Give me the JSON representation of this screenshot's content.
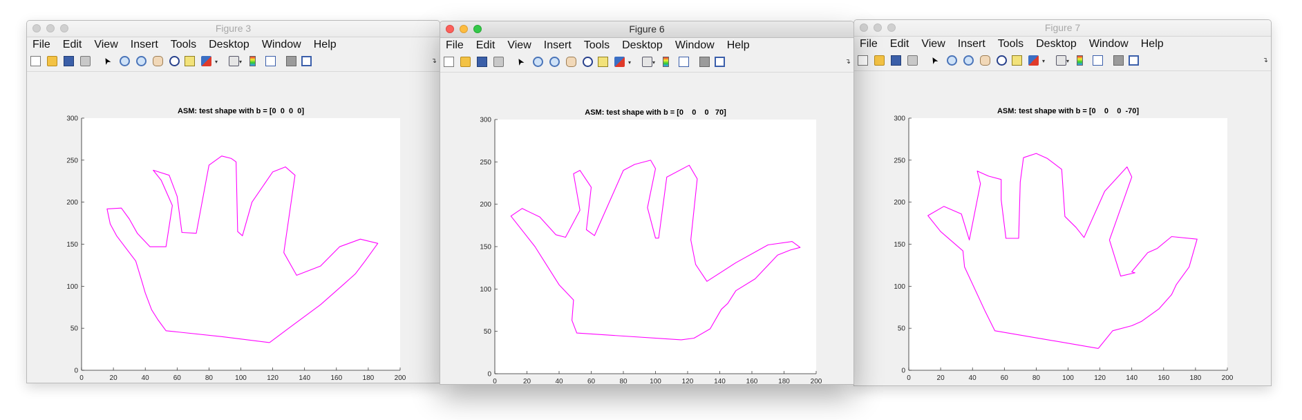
{
  "menus": [
    "File",
    "Edit",
    "View",
    "Insert",
    "Tools",
    "Desktop",
    "Window",
    "Help"
  ],
  "toolbar_icons": [
    "new-file-icon",
    "open-folder-icon",
    "save-icon",
    "print-icon",
    "pointer-icon",
    "zoom-in-icon",
    "zoom-out-icon",
    "pan-icon",
    "rotate-3d-icon",
    "data-cursor-icon",
    "brush-icon",
    "link-plot-icon",
    "colorbar-icon",
    "legend-icon",
    "hide-plot-tools-icon",
    "show-plot-tools-icon"
  ],
  "colors": {
    "curve": "#ff00ff",
    "axes_bg": "#ffffff",
    "figure_bg": "#f0f0f0"
  },
  "windows": [
    {
      "id": "figure3",
      "title": "Figure 3",
      "active": false
    },
    {
      "id": "figure6",
      "title": "Figure 6",
      "active": true
    },
    {
      "id": "figure7",
      "title": "Figure 7",
      "active": false
    }
  ],
  "chart_data": [
    {
      "type": "line",
      "title": "ASM: test shape with b = [0  0  0  0]",
      "xlim": [
        0,
        200
      ],
      "ylim": [
        0,
        300
      ],
      "xticks": [
        0,
        20,
        40,
        60,
        80,
        100,
        120,
        140,
        160,
        180,
        200
      ],
      "yticks": [
        0,
        50,
        100,
        150,
        200,
        250,
        300
      ],
      "grid": false,
      "series": [
        {
          "x": [
            118,
            130,
            150,
            165,
            172,
            178,
            186,
            175,
            162,
            150,
            135,
            127,
            134,
            128,
            120,
            107,
            101,
            98,
            97,
            94,
            88,
            80,
            72,
            63,
            60,
            55,
            45,
            50,
            57,
            53,
            43,
            35,
            30,
            25,
            16,
            18,
            22,
            28,
            34,
            38,
            40,
            44,
            48,
            53,
            88,
            118
          ],
          "y": [
            33,
            50,
            78,
            103,
            115,
            130,
            151,
            156,
            147,
            124,
            113,
            140,
            232,
            242,
            236,
            200,
            160,
            165,
            248,
            252,
            255,
            244,
            163,
            164,
            207,
            232,
            238,
            226,
            196,
            147,
            147,
            163,
            180,
            193,
            192,
            174,
            160,
            145,
            130,
            105,
            92,
            72,
            60,
            47,
            40,
            33
          ]
        }
      ]
    },
    {
      "type": "line",
      "title": "ASM: test shape with b = [0    0    0   70]",
      "xlim": [
        0,
        200
      ],
      "ylim": [
        0,
        300
      ],
      "xticks": [
        0,
        20,
        40,
        60,
        80,
        100,
        120,
        140,
        160,
        180,
        200
      ],
      "yticks": [
        0,
        50,
        100,
        150,
        200,
        250,
        300
      ],
      "grid": false,
      "series": [
        {
          "x": [
            116,
            124,
            134,
            141,
            145,
            150,
            162,
            176,
            184,
            190,
            185,
            170,
            150,
            132,
            125,
            122,
            126,
            121,
            107,
            102,
            100,
            95,
            100,
            97,
            87,
            80,
            62,
            57,
            60,
            53,
            49,
            53,
            44,
            38,
            28,
            17,
            10,
            25,
            40,
            49,
            48,
            51,
            116
          ],
          "y": [
            40,
            42,
            53,
            76,
            83,
            98,
            112,
            140,
            146,
            149,
            156,
            152,
            131,
            109,
            129,
            158,
            230,
            246,
            232,
            160,
            160,
            196,
            242,
            252,
            247,
            240,
            163,
            170,
            220,
            240,
            236,
            193,
            161,
            164,
            185,
            195,
            186,
            150,
            105,
            87,
            63,
            48,
            40
          ]
        }
      ]
    },
    {
      "type": "line",
      "title": "ASM: test shape with b = [0    0    0  -70]",
      "xlim": [
        0,
        200
      ],
      "ylim": [
        0,
        300
      ],
      "xticks": [
        0,
        20,
        40,
        60,
        80,
        100,
        120,
        140,
        160,
        180,
        200
      ],
      "yticks": [
        0,
        50,
        100,
        150,
        200,
        250,
        300
      ],
      "grid": false,
      "series": [
        {
          "x": [
            119,
            128,
            140,
            146,
            157,
            165,
            168,
            176,
            181,
            165,
            156,
            150,
            140,
            142,
            133,
            126,
            140,
            137,
            123,
            110,
            105,
            98,
            96,
            87,
            80,
            72,
            70,
            69,
            61,
            58,
            58,
            50,
            43,
            45,
            38,
            33,
            22,
            12,
            20,
            34,
            35,
            48,
            54,
            119
          ],
          "y": [
            26,
            47,
            53,
            58,
            73,
            90,
            102,
            123,
            156,
            159,
            145,
            140,
            117,
            116,
            112,
            155,
            230,
            242,
            213,
            158,
            170,
            183,
            239,
            252,
            258,
            253,
            224,
            157,
            157,
            203,
            227,
            231,
            237,
            222,
            155,
            186,
            195,
            184,
            165,
            142,
            123,
            70,
            47,
            26
          ]
        }
      ]
    }
  ]
}
